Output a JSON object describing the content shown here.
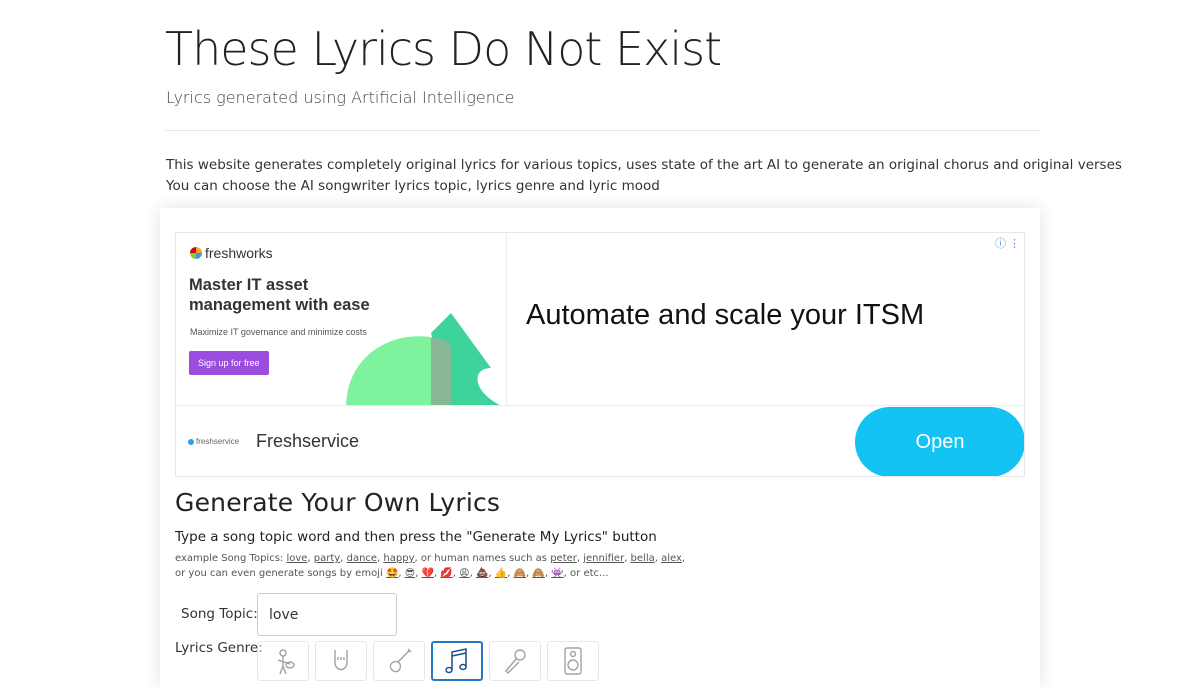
{
  "header": {
    "title": "These Lyrics Do Not Exist",
    "subtitle": "Lyrics generated using Artificial Intelligence"
  },
  "intro": {
    "line1": "This website generates completely original lyrics for various topics, uses state of the art AI to generate an original chorus and original verses",
    "line2": "You can choose the AI songwriter lyrics topic, lyrics genre and lyric mood"
  },
  "ad": {
    "brand": "freshworks",
    "headline_line1": "Master IT asset",
    "headline_line2": "management with ease",
    "small_text": "Maximize IT governance and minimize costs",
    "signup_label": "Sign up for free",
    "main_text": "Automate and scale your ITSM",
    "info_icon": "info-icon",
    "footer_logo_text": "freshservice",
    "footer_name": "Freshservice",
    "open_label": "Open",
    "colors": {
      "open": "#12c3f4",
      "signup": "#9b4de0"
    }
  },
  "generator": {
    "title": "Generate Your Own Lyrics",
    "description": "Type a song topic word and then press the \"Generate My Lyrics\" button",
    "examples_prefix": "example Song Topics:",
    "example_topics": [
      "love",
      "party",
      "dance",
      "happy"
    ],
    "names_prefix": ", or human names such as",
    "example_names": [
      "peter",
      "jennifier",
      "bella",
      "alex"
    ],
    "emoji_prefix": "or you can even generate songs by emoji",
    "emojis": [
      "🤩",
      "😎",
      "💔",
      "💋",
      "😩",
      "💩",
      "👍",
      "🙈",
      "🙈",
      "👾"
    ],
    "emoji_suffix": "or etc...",
    "topic_label": "Song Topic:",
    "topic_value": "love",
    "genre_label": "Lyrics Genre:",
    "genres": [
      "guitar-player-icon",
      "rock-hand-icon",
      "electric-guitar-icon",
      "music-note-icon",
      "microphone-icon",
      "speaker-icon"
    ],
    "selected_genre": "music-note-icon"
  }
}
